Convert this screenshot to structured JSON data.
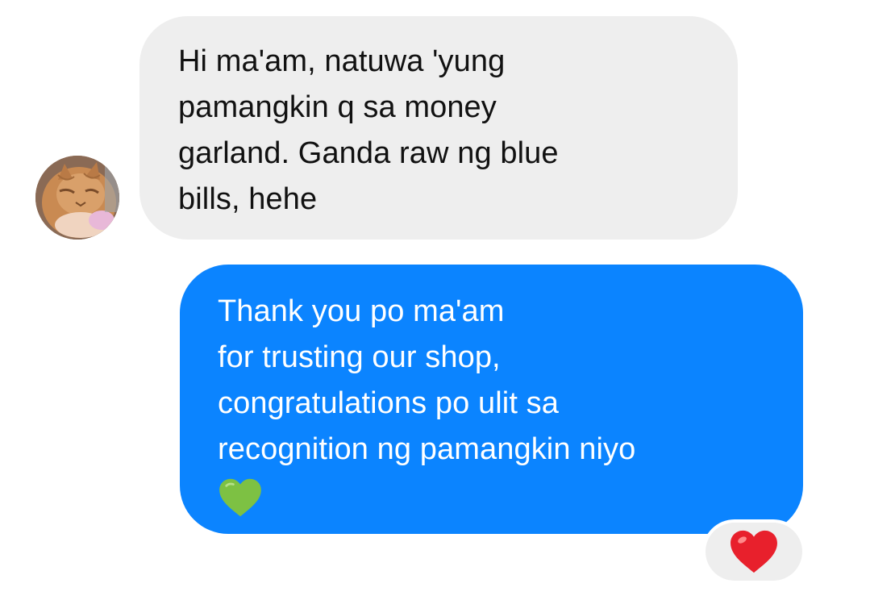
{
  "conversation": {
    "incoming": {
      "lines": [
        "Hi ma'am, natuwa 'yung",
        "pamangkin q sa money",
        "garland. Ganda raw ng blue",
        "bills, hehe"
      ]
    },
    "outgoing": {
      "lines": [
        "Thank you po ma'am",
        "for trusting our shop,",
        "congratulations po ulit sa",
        "recognition ng pamangkin niyo"
      ],
      "emoji": "green-heart-icon"
    },
    "reaction": {
      "emoji": "red-heart-icon"
    }
  },
  "colors": {
    "incoming_bubble": "#eeeeee",
    "outgoing_bubble": "#0b84ff",
    "incoming_text": "#111111",
    "outgoing_text": "#ffffff",
    "reaction_heart": "#e8202c",
    "green_heart": "#7dc143"
  }
}
